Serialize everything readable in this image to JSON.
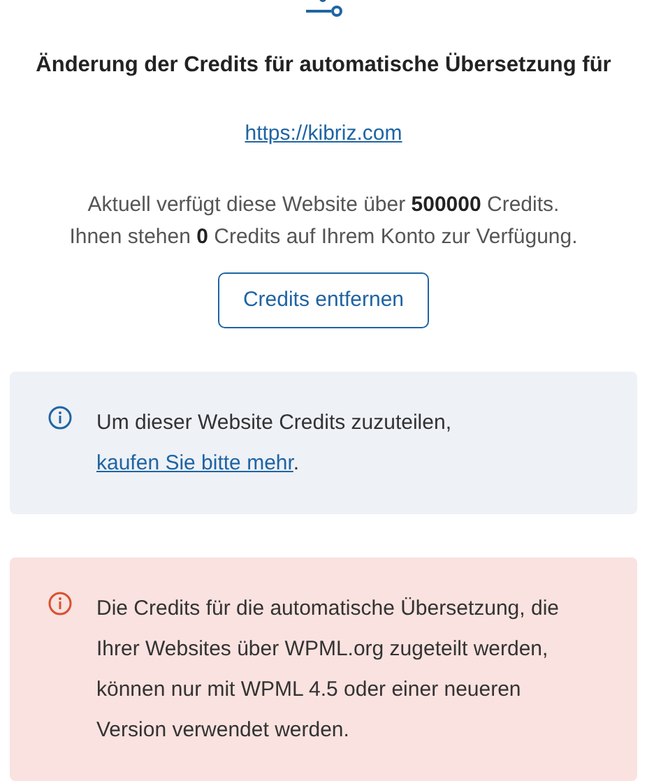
{
  "title": "Änderung der Credits für automatische Übersetzung für",
  "site_link": "https://kibriz.com",
  "summary": [
    "Aktuell verfügt diese Website über **500000** Credits.",
    "Ihnen stehen **0** Credits auf Ihrem Konto zur Verfügung."
  ],
  "button": "Credits entfernen",
  "notices": [
    {
      "kind": "info",
      "text": "Um dieser Website Credits zuzuteilen, ",
      "link": "kaufen Sie bitte mehr",
      "suffix": "."
    },
    {
      "kind": "error",
      "text": "Die Credits für die automatische Übersetzung, die Ihrer Websites über WPML.org zugeteilt werden, können nur mit WPML 4.5 oder einer neueren Version verwendet werden."
    }
  ]
}
